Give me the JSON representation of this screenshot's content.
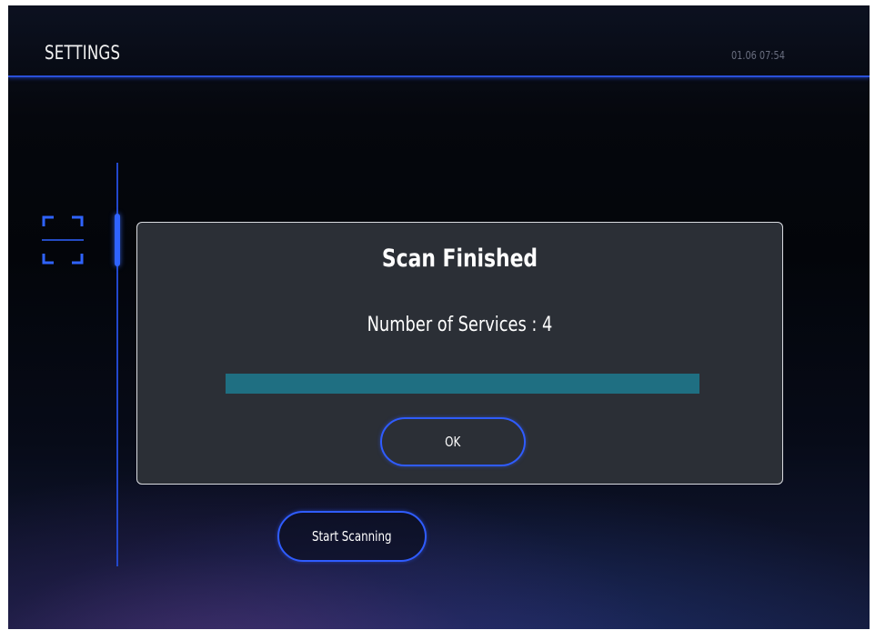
{
  "header": {
    "title": "SETTINGS",
    "clock": "01.06 07:54"
  },
  "sidebar": {
    "active_icon": "scan-frame-icon"
  },
  "dialog": {
    "title": "Scan Finished",
    "message": "Number of Services : 4",
    "progress_fraction": 1.0,
    "ok_label": "OK"
  },
  "main": {
    "start_scanning_label": "Start Scanning"
  },
  "colors": {
    "accent": "#2f5cff",
    "progress": "#1f6f82",
    "dialog_bg": "#2b2f36"
  }
}
